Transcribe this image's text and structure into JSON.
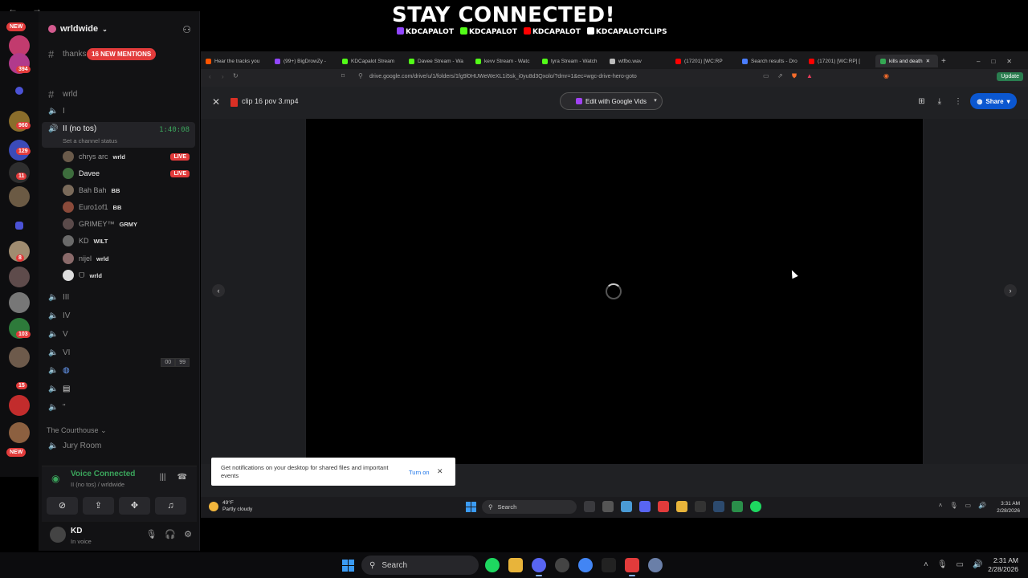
{
  "banner": {
    "title": "STAY CONNECTED!",
    "handles": [
      "KDCAPALOT",
      "KDCAPALOT",
      "KDCAPALOT",
      "KDCAPALOTCLIPS"
    ]
  },
  "server": {
    "name": "wrldwide",
    "mentions": "16 NEW MENTIONS",
    "rail_badges": [
      "NEW",
      "394",
      "960",
      "129",
      "11",
      "8",
      "103",
      "15",
      "NEW"
    ]
  },
  "channels": {
    "thanks": "thanks",
    "wrld": "wrld",
    "I": "I",
    "active": "II (no tos)",
    "active_time": "1:40:08",
    "status_prompt": "Set a channel status",
    "III": "III",
    "IV": "IV",
    "V": "V",
    "VI": "VI",
    "vi_count_a": "00",
    "vi_count_b": "99",
    "extra": "\"",
    "category": "The Courthouse",
    "jury": "Jury Room"
  },
  "voice_users": [
    {
      "name": "chrys arc",
      "tag": "wrld",
      "live": "LIVE"
    },
    {
      "name": "Davee",
      "tag": "",
      "live": "LIVE"
    },
    {
      "name": "Bah Bah",
      "tag": "BB",
      "live": ""
    },
    {
      "name": "Euro1of1",
      "tag": "BB",
      "live": ""
    },
    {
      "name": "GRIMEY™",
      "tag": "GRMY",
      "live": ""
    },
    {
      "name": "KD",
      "tag": "WILT",
      "live": ""
    },
    {
      "name": "nijel",
      "tag": "wrld",
      "live": ""
    },
    {
      "name": "ᗜ",
      "tag": "wrld",
      "live": ""
    }
  ],
  "voice_panel": {
    "title": "Voice Connected",
    "sub": "II (no tos) / wrldwide"
  },
  "user_panel": {
    "name": "KD",
    "status": "In voice"
  },
  "browser": {
    "tabs": [
      "Hear the tracks you",
      "(99+) BigDrowZy -",
      "KDCapalot Stream",
      "Davee Stream - Wa",
      "kevv Stream - Watc",
      "tyra Stream - Watch",
      "wtfbo.wav",
      "(17201) [WC:RP",
      "Search results - Dro",
      "(17201) [WC:RP] [",
      "kills and death"
    ],
    "url": "drive.google.com/drive/u/1/folders/1fg9l0HUWeWeXL1i5sk_i0yu8d3Qxolo/?dmr=1&ec=wgc-drive-hero-goto",
    "update": "Update"
  },
  "drive": {
    "file_name": "clip 16 pov 3.mp4",
    "edit_label": "Edit with Google Vids",
    "share_label": "Share"
  },
  "notification": {
    "text": "Get notifications on your desktop for shared files and important events",
    "action": "Turn on"
  },
  "inner_taskbar": {
    "temp": "49°F",
    "weather": "Partly cloudy",
    "search": "Search",
    "time": "3:31 AM",
    "date": "2/28/2026"
  },
  "taskbar": {
    "search": "Search",
    "time": "2:31 AM",
    "date": "2/28/2026"
  },
  "colors": {
    "accent_green": "#3ba55c",
    "mention_red": "#e23b3b",
    "share_blue": "#0b57d0"
  }
}
